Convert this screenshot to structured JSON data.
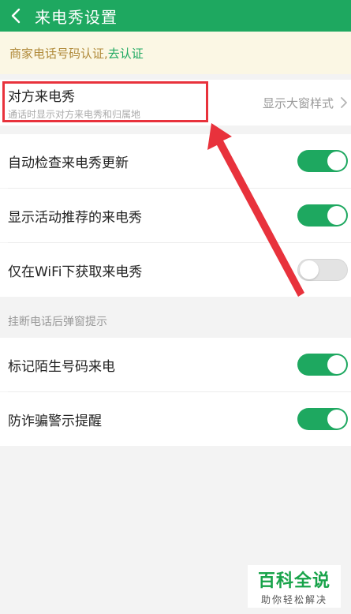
{
  "header": {
    "title": "来电秀设置",
    "back_icon": "chevron-left-icon"
  },
  "banner": {
    "text": "商家电话号码认证,",
    "link": "去认证"
  },
  "caller_show": {
    "title": "对方来电秀",
    "subtitle": "通话时显示对方来电秀和归属地",
    "value": "显示大窗样式"
  },
  "settings": [
    {
      "label": "自动检查来电秀更新",
      "enabled": true
    },
    {
      "label": "显示活动推荐的来电秀",
      "enabled": true
    },
    {
      "label": "仅在WiFi下获取来电秀",
      "enabled": false
    }
  ],
  "section_label": "挂断电话后弹窗提示",
  "hangup_settings": [
    {
      "label": "标记陌生号码来电",
      "enabled": true
    },
    {
      "label": "防诈骗警示提醒",
      "enabled": true
    }
  ],
  "watermark": {
    "main": "百科全说",
    "sub": "助你轻松解决"
  },
  "colors": {
    "accent": "#1ea860",
    "highlight": "#e8323c",
    "banner_bg": "#fbf7e4"
  }
}
